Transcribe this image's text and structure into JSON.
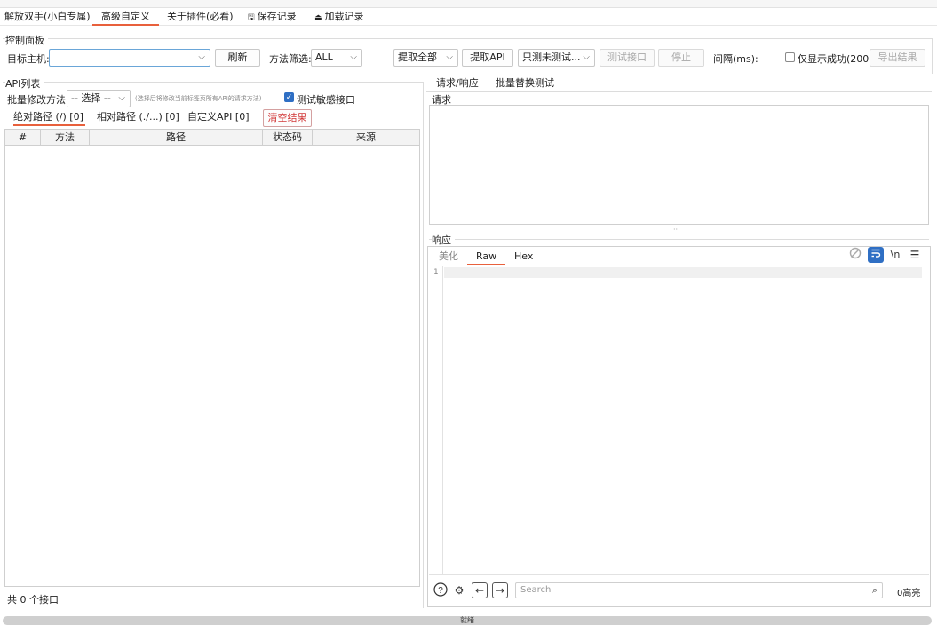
{
  "main_tabs": [
    {
      "label": "解放双手(小白专属)"
    },
    {
      "label": "高级自定义"
    },
    {
      "label": "关于插件(必看)"
    },
    {
      "label": "保存记录"
    },
    {
      "label": "加载记录"
    }
  ],
  "control_panel": {
    "title": "控制面板",
    "target_host_label": "目标主机:",
    "target_host_value": "",
    "refresh_label": "刷新",
    "method_filter_label": "方法筛选:",
    "method_filter_value": "ALL",
    "extract_all_value": "提取全部",
    "extract_api_label": "提取API",
    "only_untested_value": "只测未测试...",
    "test_api_label": "测试接口",
    "stop_label": "停止",
    "interval_label": "间隔(ms):",
    "only_success_label": "仅显示成功(200)",
    "export_label": "导出结果"
  },
  "api_list": {
    "title": "API列表",
    "batch_method_label": "批量修改方法:",
    "batch_method_value": "-- 选择 --",
    "batch_hint": "(选择后将修改当前标签页所有API的请求方法)",
    "test_sensitive_label": "测试敏感接口",
    "tabs": [
      {
        "label": "绝对路径 (/) [0]"
      },
      {
        "label": "相对路径 (./...) [0]"
      },
      {
        "label": "自定义API [0]"
      }
    ],
    "clear_label": "清空结果",
    "columns": [
      "#",
      "方法",
      "路径",
      "状态码",
      "来源"
    ],
    "footer": "共 0 个接口"
  },
  "right_panel": {
    "tabs": [
      {
        "label": "请求/响应"
      },
      {
        "label": "批量替换测试"
      }
    ],
    "request_title": "请求",
    "response_title": "响应",
    "response_tabs": [
      {
        "label": "美化"
      },
      {
        "label": "Raw"
      },
      {
        "label": "Hex"
      }
    ],
    "line_number": "1",
    "newline_toggle": "\\n",
    "search_placeholder": "Search",
    "highlight_count": "0高亮"
  },
  "status_bar": {
    "text": "就绪"
  },
  "colors": {
    "accent": "#e8603c",
    "checkbox": "#2f6fc4",
    "wrap_icon": "#2f6fc4"
  }
}
